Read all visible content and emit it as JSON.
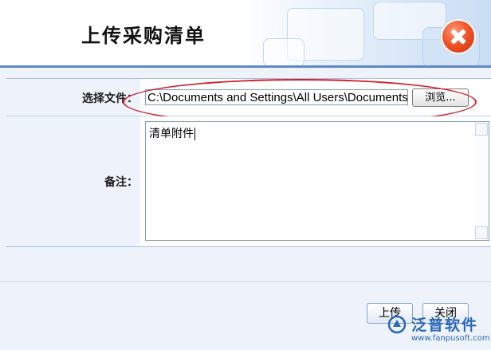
{
  "dialog": {
    "title": "上传采购清单",
    "close_icon": "close-icon"
  },
  "form": {
    "file_label": "选择文件：",
    "file_value": "C:\\Documents and Settings\\All Users\\Documents",
    "browse_label": "浏览...",
    "remark_label": "备注：",
    "remark_value": "清单附件"
  },
  "buttons": {
    "upload": "上传",
    "close": "关闭"
  },
  "watermark": {
    "brand": "泛普软件",
    "url": "www.fanpusoft.com"
  },
  "colors": {
    "accent_line": "#5f88c4",
    "annotation": "#d0202a",
    "close_button": "#f2542a",
    "panel_background": "#eef3fb"
  }
}
